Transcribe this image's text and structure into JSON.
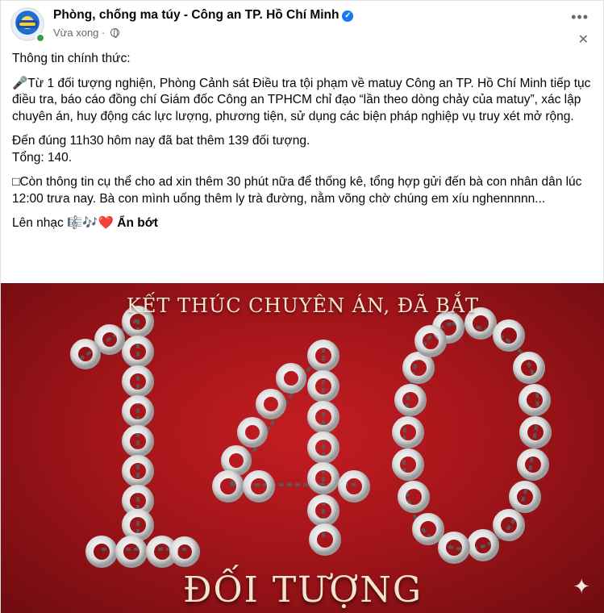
{
  "post": {
    "page_name": "Phòng, chống ma túy - Công an TP. Hồ Chí Minh",
    "verified_icon": "verified-badge-icon",
    "timestamp": "Vừa xong",
    "separator": " · ",
    "privacy_icon": "globe-icon",
    "more_icon": "more-horizontal-icon",
    "close_icon": "close-icon",
    "paragraphs": [
      "Thông tin chính thức:",
      "🎤Từ 1 đối tượng nghiện, Phòng Cảnh sát Điều tra tội phạm về matuy Công an TP. Hồ Chí Minh tiếp tục điều tra, báo cáo đồng chí Giám đốc Công an TPHCM chỉ đạo “lần theo dòng chảy của matuy”, xác lập chuyên án, huy động các lực lượng, phương tiện, sử dụng các biện pháp nghiệp vụ truy xét mở rộng.",
      "Đến đúng 11h30 hôm nay đã bat thêm 139 đối tượng.",
      "Tổng: 140.",
      "Còn thông tin cụ thể cho ad xin thêm 30 phút nữa để thống kê, tổng hợp gửi đến bà con nhân dân lúc 12:00 trưa nay. Bà con mình uống thêm ly trà đường, nằm võng chờ chúng em xíu nghennnnn...",
      "Lên nhạc 🎼🎶❤️"
    ],
    "see_less": "Ẩn bớt",
    "image": {
      "headline": "KẾT THÚC CHUYÊN ÁN, ĐÃ BẮT",
      "number": "140",
      "footline": "ĐỐI TƯỢNG",
      "sparkle_icon": "sparkle-icon",
      "colors": {
        "background": "#b3171c",
        "cuff": "#f2f2f2"
      }
    }
  }
}
